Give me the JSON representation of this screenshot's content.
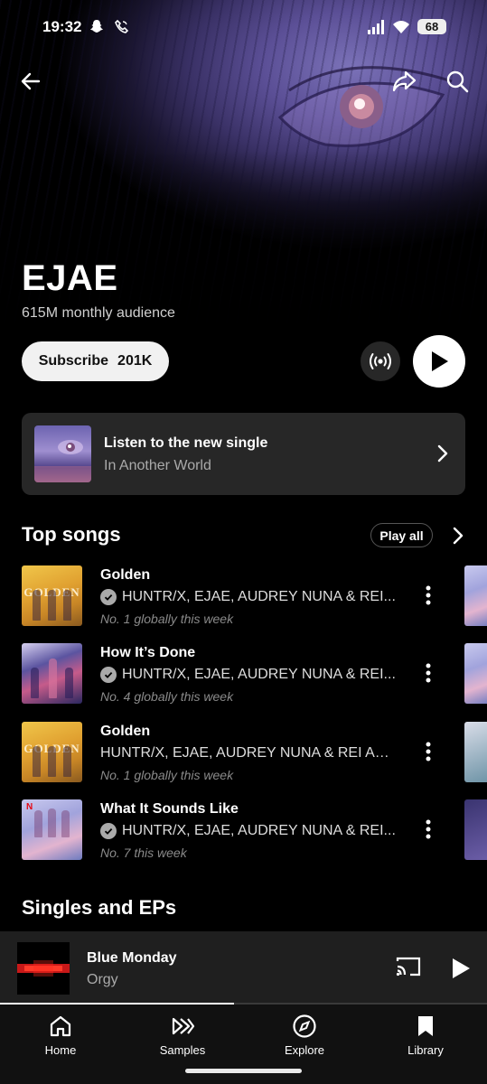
{
  "status_bar": {
    "time": "19:32",
    "battery": "68"
  },
  "artist": {
    "name": "EJAE",
    "audience": "615M monthly audience"
  },
  "actions": {
    "subscribe_label": "Subscribe",
    "subscriber_count": "201K"
  },
  "new_single": {
    "title": "Listen to the new single",
    "name": "In Another World"
  },
  "top_songs": {
    "heading": "Top songs",
    "play_all": "Play all",
    "items": [
      {
        "title": "Golden",
        "artist": "HUNTR/X, EJAE, AUDREY NUNA & REI...",
        "verified": true,
        "rank": "No. 1 globally this week",
        "art": "golden"
      },
      {
        "title": "How It’s Done",
        "artist": "HUNTR/X, EJAE, AUDREY NUNA & REI...",
        "verified": true,
        "rank": "No. 4 globally this week",
        "art": "howdone"
      },
      {
        "title": "Golden",
        "artist": "HUNTR/X, EJAE, AUDREY NUNA & REI AMI...",
        "verified": false,
        "rank": "No. 1 globally this week",
        "art": "golden"
      },
      {
        "title": "What It Sounds Like",
        "artist": "HUNTR/X, EJAE, AUDREY NUNA & REI...",
        "verified": true,
        "rank": "No. 7 this week",
        "art": "wisl"
      }
    ]
  },
  "singles_heading": "Singles and EPs",
  "now_playing": {
    "title": "Blue Monday",
    "artist": "Orgy",
    "progress": 0.48
  },
  "bottom_nav": [
    {
      "label": "Home",
      "icon": "home-icon"
    },
    {
      "label": "Samples",
      "icon": "samples-icon"
    },
    {
      "label": "Explore",
      "icon": "explore-icon"
    },
    {
      "label": "Library",
      "icon": "library-icon"
    }
  ],
  "colors": {
    "background": "#000000",
    "card": "#272727",
    "mini_player": "#1f1f1f",
    "nav": "#111111"
  }
}
